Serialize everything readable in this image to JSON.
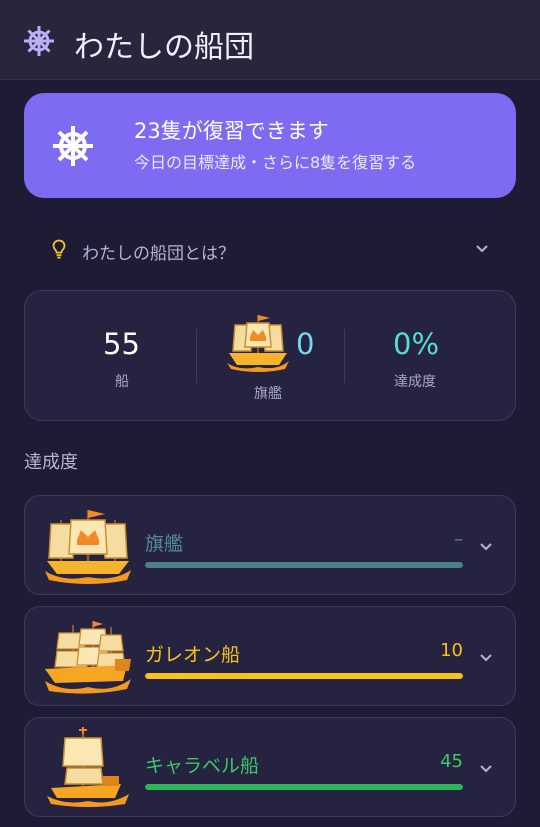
{
  "header": {
    "title": "わたしの船団",
    "icon": "ship-wheel-icon"
  },
  "banner": {
    "icon": "ship-wheel-icon",
    "title": "23隻が復習できます",
    "subtitle": "今日の目標達成・さらに8隻を復習する",
    "color": "#7d6cf2"
  },
  "about": {
    "label": "わたしの船団とは？",
    "icon": "lightbulb-icon"
  },
  "stats": {
    "ships": {
      "value": "55",
      "label": "船"
    },
    "flagship": {
      "value": "0",
      "label": "旗艦"
    },
    "completion": {
      "value": "0%",
      "label": "達成度"
    }
  },
  "section": {
    "title": "達成度"
  },
  "categories": [
    {
      "name": "旗艦",
      "count": "–",
      "progress": 0,
      "name_color": "#4f8c92",
      "bar_color": "#4a7f86",
      "icon": "flagship-icon"
    },
    {
      "name": "ガレオン船",
      "count": "10",
      "progress": 1,
      "name_color": "#f6c21c",
      "bar_color": "#f6c21c",
      "icon": "galleon-icon"
    },
    {
      "name": "キャラベル船",
      "count": "45",
      "progress": 1,
      "name_color": "#3ec86a",
      "bar_color": "#2fb457",
      "icon": "caravel-icon"
    }
  ]
}
